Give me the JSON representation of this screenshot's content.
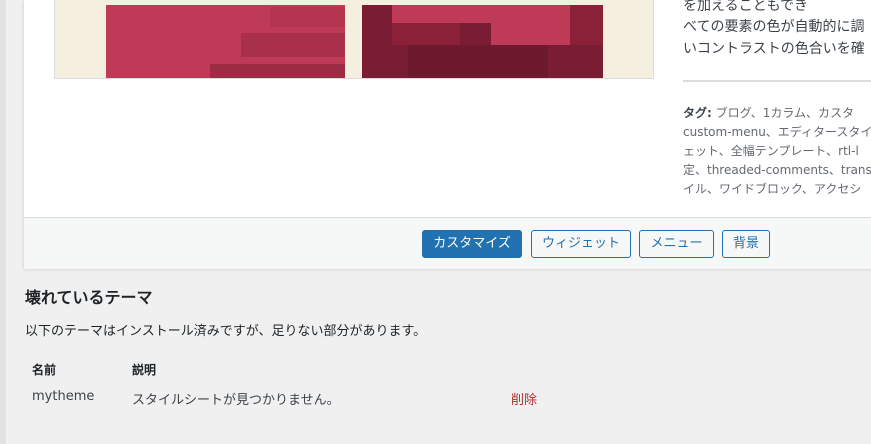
{
  "theme_card": {
    "description_lines": [
      "を加えることもでき",
      "べての要素の色が自動的に調",
      "いコントラストの色合いを確"
    ],
    "tags_label": "タグ:",
    "tags_lines": [
      " ブログ、1カラム、カスタ",
      "custom-menu、エディタースタイ",
      "ェット、全幅テンプレート、rtl-l",
      "定、threaded-comments、transl",
      "イル、ワイドブロック、アクセシ"
    ],
    "buttons": {
      "customize": "カスタマイズ",
      "widgets": "ウィジェット",
      "menus": "メニュー",
      "background": "背景"
    },
    "screenshot_colors": {
      "background": "#f5efe0",
      "primary": "#bf3a57",
      "dark": "#7a1c33"
    }
  },
  "broken_themes": {
    "title": "壊れているテーマ",
    "description": "以下のテーマはインストール済みですが、足りない部分があります。",
    "columns": {
      "name": "名前",
      "description": "説明"
    },
    "rows": [
      {
        "name": "mytheme",
        "description": "スタイルシートが見つかりません。",
        "action": "削除"
      }
    ]
  }
}
